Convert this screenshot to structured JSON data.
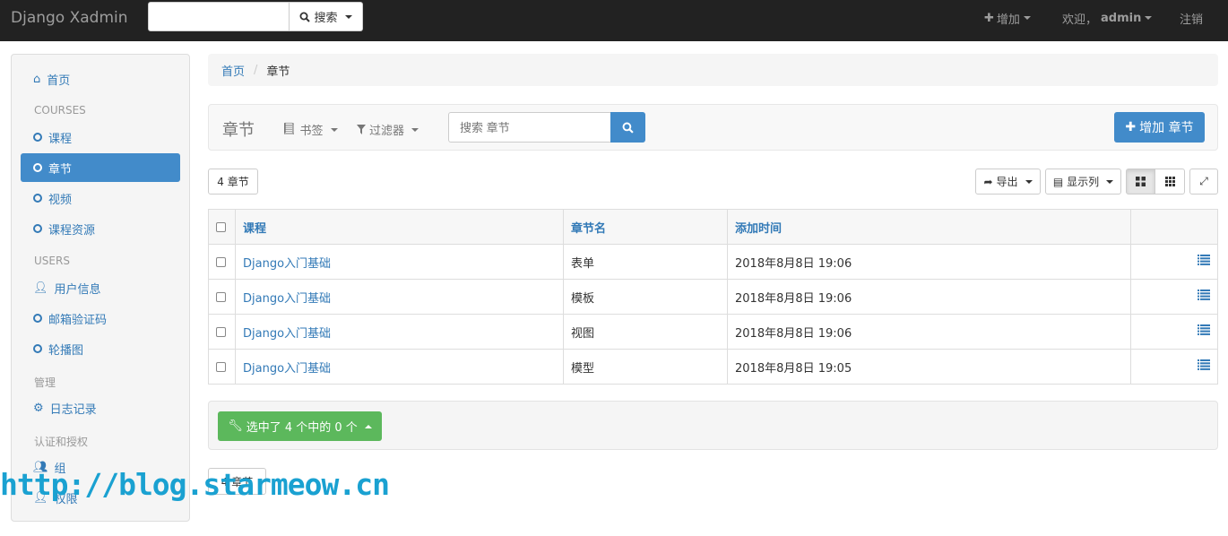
{
  "navbar": {
    "brand": "Django Xadmin",
    "search_button": "搜索",
    "add_label": "增加",
    "welcome_label": "欢迎，",
    "username": "admin",
    "logout_label": "注销"
  },
  "sidebar": {
    "home": "首页",
    "sections": [
      {
        "header": "COURSES",
        "items": [
          "课程",
          "章节",
          "视频",
          "课程资源"
        ]
      },
      {
        "header": "USERS",
        "items": [
          "用户信息",
          "邮箱验证码",
          "轮播图"
        ]
      },
      {
        "header": "管理",
        "items": [
          "日志记录"
        ]
      },
      {
        "header": "认证和授权",
        "items": [
          "组",
          "权限"
        ]
      }
    ],
    "active_item": "章节"
  },
  "breadcrumb": {
    "home": "首页",
    "current": "章节"
  },
  "toolbar": {
    "title": "章节",
    "bookmarks_label": "书签",
    "filter_label": "过滤器",
    "search_placeholder": "搜索 章节",
    "add_button": "增加 章节"
  },
  "results": {
    "count_label": "4 章节",
    "export_label": "导出",
    "columns_label": "显示列"
  },
  "table": {
    "headers": [
      "课程",
      "章节名",
      "添加时间"
    ],
    "rows": [
      {
        "course": "Django入门基础",
        "name": "表单",
        "time": "2018年8月8日 19:06"
      },
      {
        "course": "Django入门基础",
        "name": "模板",
        "time": "2018年8月8日 19:06"
      },
      {
        "course": "Django入门基础",
        "name": "视图",
        "time": "2018年8月8日 19:06"
      },
      {
        "course": "Django入门基础",
        "name": "模型",
        "time": "2018年8月8日 19:05"
      }
    ]
  },
  "actions": {
    "selected_label": "选中了 4 个中的 0 个"
  },
  "footer": {
    "count_label": "4 章节"
  },
  "watermark": "http://blog.starmeow.cn",
  "colors": {
    "primary": "#428bca",
    "success": "#5cb85c",
    "navbar": "#222222",
    "watermark": "#1aa1d1"
  }
}
